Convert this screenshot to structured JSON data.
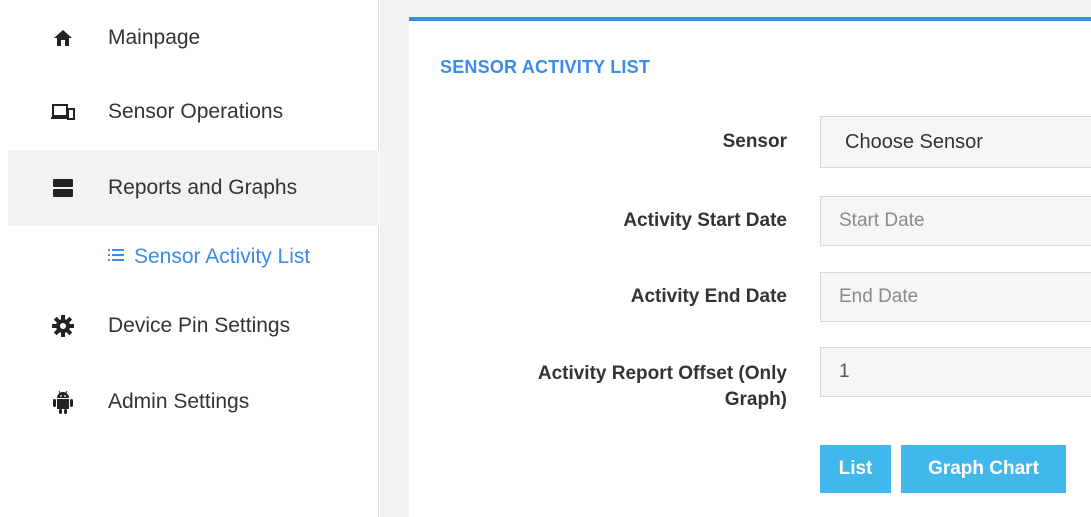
{
  "sidebar": {
    "items": [
      {
        "label": "Mainpage",
        "icon": "home-icon"
      },
      {
        "label": "Sensor Operations",
        "icon": "devices-icon"
      },
      {
        "label": "Reports and Graphs",
        "icon": "server-icon"
      },
      {
        "label": "Device Pin Settings",
        "icon": "gear-icon"
      },
      {
        "label": "Admin Settings",
        "icon": "android-icon"
      }
    ],
    "subitem": {
      "label": "Sensor Activity List",
      "icon": "list-icon"
    }
  },
  "panel": {
    "title": "SENSOR ACTIVITY LIST",
    "fields": {
      "sensor": {
        "label": "Sensor",
        "value": "Choose Sensor"
      },
      "start_date": {
        "label": "Activity Start Date",
        "placeholder": "Start Date"
      },
      "end_date": {
        "label": "Activity End Date",
        "placeholder": "End Date"
      },
      "offset": {
        "label_line1": "Activity Report Offset (Only",
        "label_line2": "Graph)",
        "value": "1"
      }
    },
    "buttons": {
      "list": "List",
      "graph_chart": "Graph Chart"
    }
  },
  "colors": {
    "accent": "#3b8beb",
    "button": "#41b8ec",
    "active_bg": "#f2f2f2"
  }
}
